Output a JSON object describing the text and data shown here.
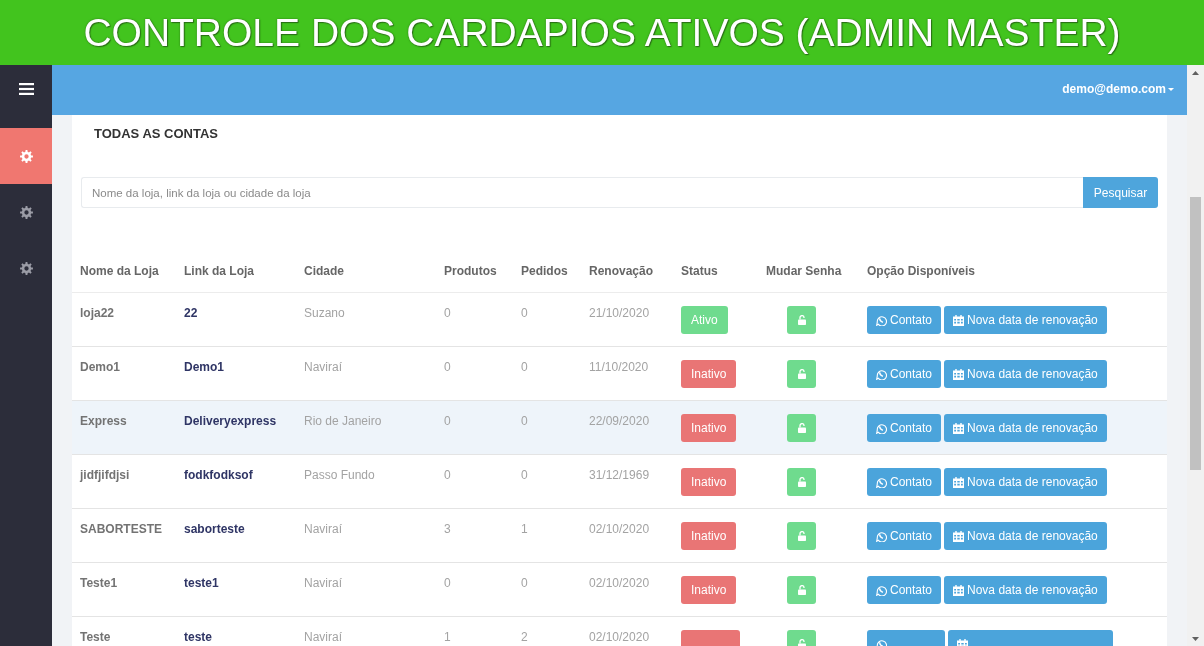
{
  "banner": {
    "title": "CONTROLE DOS CARDAPIOS ATIVOS (ADMIN MASTER)"
  },
  "sidebar": {
    "items": [
      {
        "selected": true
      },
      {
        "selected": false
      },
      {
        "selected": false
      }
    ]
  },
  "top_bar": {
    "user": "demo@demo.com"
  },
  "panel": {
    "title": "TODAS AS CONTAS",
    "search": {
      "placeholder": "Nome da loja, link da loja ou cidade da loja",
      "button": "Pesquisar"
    }
  },
  "table": {
    "columns": [
      "Nome da Loja",
      "Link da Loja",
      "Cidade",
      "Produtos",
      "Pedidos",
      "Renovação",
      "Status",
      "Mudar Senha",
      "Opção Disponíveis"
    ],
    "rows": [
      {
        "name": "loja22",
        "link": "22",
        "city": "Suzano",
        "products": "0",
        "orders": "0",
        "renewal": "21/10/2020",
        "status": {
          "label": "Ativo",
          "active": true
        },
        "highlighted": false,
        "actions": [
          {
            "kind": "contact",
            "label": "Contato"
          },
          {
            "kind": "renew",
            "label": "Nova data de renovação"
          }
        ]
      },
      {
        "name": "Demo1",
        "link": "Demo1",
        "city": "Naviraí",
        "products": "0",
        "orders": "0",
        "renewal": "11/10/2020",
        "status": {
          "label": "Inativo",
          "active": false
        },
        "highlighted": false,
        "actions": [
          {
            "kind": "contact",
            "label": "Contato"
          },
          {
            "kind": "renew",
            "label": "Nova data de renovação"
          }
        ]
      },
      {
        "name": "Express",
        "link": "Deliveryexpress",
        "city": "Rio de Janeiro",
        "products": "0",
        "orders": "0",
        "renewal": "22/09/2020",
        "status": {
          "label": "Inativo",
          "active": false
        },
        "highlighted": true,
        "actions": [
          {
            "kind": "contact",
            "label": "Contato"
          },
          {
            "kind": "renew",
            "label": "Nova data de renovação"
          }
        ]
      },
      {
        "name": "jidfjifdjsi",
        "link": "fodkfodksof",
        "city": "Passo Fundo",
        "products": "0",
        "orders": "0",
        "renewal": "31/12/1969",
        "status": {
          "label": "Inativo",
          "active": false
        },
        "highlighted": false,
        "actions": [
          {
            "kind": "contact",
            "label": "Contato"
          },
          {
            "kind": "renew",
            "label": "Nova data de renovação"
          }
        ]
      },
      {
        "name": "SABORTESTE",
        "link": "saborteste",
        "city": "Naviraí",
        "products": "3",
        "orders": "1",
        "renewal": "02/10/2020",
        "status": {
          "label": "Inativo",
          "active": false
        },
        "highlighted": false,
        "actions": [
          {
            "kind": "contact",
            "label": "Contato"
          },
          {
            "kind": "renew",
            "label": "Nova data de renovação"
          }
        ]
      },
      {
        "name": "Teste1",
        "link": "teste1",
        "city": "Naviraí",
        "products": "0",
        "orders": "0",
        "renewal": "02/10/2020",
        "status": {
          "label": "Inativo",
          "active": false
        },
        "highlighted": false,
        "actions": [
          {
            "kind": "contact",
            "label": "Contato"
          },
          {
            "kind": "renew",
            "label": "Nova data de renovação"
          }
        ]
      },
      {
        "name": "Teste",
        "link": "teste",
        "city": "Naviraí",
        "products": "1",
        "orders": "2",
        "renewal": "02/10/2020",
        "status": {
          "active": false
        },
        "highlighted": false,
        "actions": [
          {
            "kind": "contact"
          },
          {
            "kind": "renew"
          }
        ]
      }
    ]
  }
}
